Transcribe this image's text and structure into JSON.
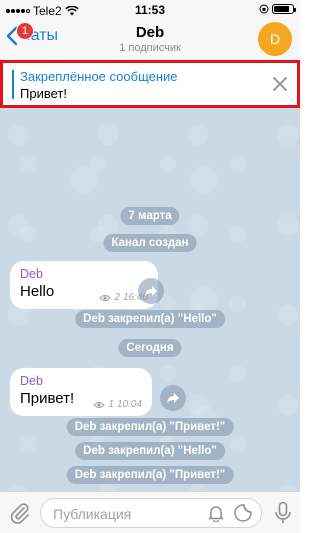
{
  "status_bar": {
    "carrier": "Tele2",
    "time": "11:53"
  },
  "header": {
    "back_label": "Чаты",
    "back_badge": "1",
    "title": "Deb",
    "subtitle": "1 подписчик",
    "avatar_letter": "D"
  },
  "pinned": {
    "title": "Закреплённое сообщение",
    "text": "Привет!"
  },
  "chat": {
    "date1": "7 марта",
    "service_created": "Канал создан",
    "msg1": {
      "sender": "Deb",
      "text": "Hello",
      "views": "2",
      "time": "16:40"
    },
    "pin1_name": "Deb",
    "pin1_rest": " закрепил(а) \"Hello\"",
    "date2": "Сегодня",
    "msg2": {
      "sender": "Deb",
      "text": "Привет!",
      "views": "1",
      "time": "10:04"
    },
    "pin2_name": "Deb",
    "pin2_rest": " закрепил(а) \"Привет!\"",
    "pin3_name": "Deb",
    "pin3_rest": " закрепил(а) \"Hello\"",
    "pin4_name": "Deb",
    "pin4_rest": " закрепил(а) \"Привет!\""
  },
  "input": {
    "placeholder": "Публикация"
  },
  "colors": {
    "accent": "#1a7fd6",
    "badge": "#e53935",
    "avatar": "#f5a623",
    "highlight_border": "#e3121b",
    "sender": "#8e5bc4"
  }
}
